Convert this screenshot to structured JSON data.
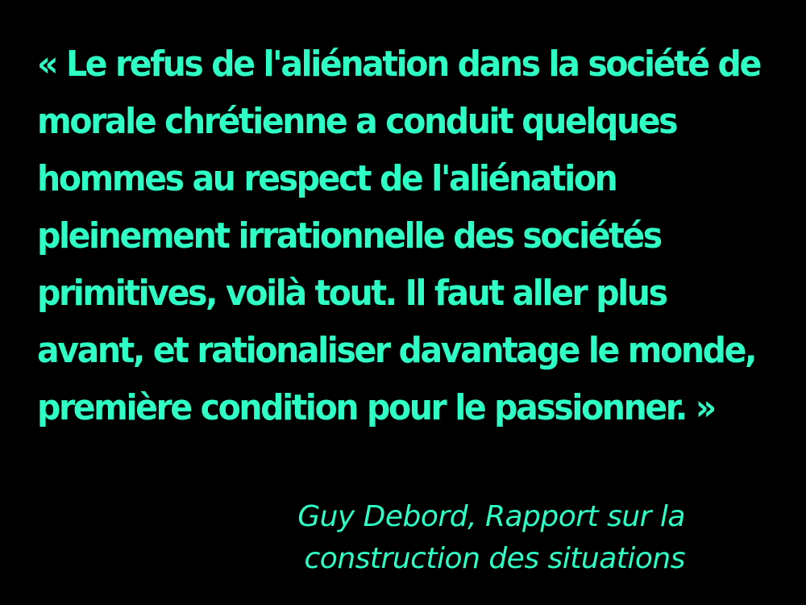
{
  "colors": {
    "background": "#000000",
    "text": "#2effc4"
  },
  "quote": {
    "lines": [
      "« Le refus de l'aliénation dans la société de",
      "morale chrétienne a conduit quelques",
      "hommes au respect de l'aliénation",
      "pleinement irrationnelle des sociétés",
      "primitives, voilà tout. Il faut aller plus",
      "avant, et rationaliser davantage le monde,",
      "première condition pour le passionner. »"
    ]
  },
  "attribution": {
    "lines": [
      "Guy Debord, Rapport sur la",
      "construction des situations"
    ]
  }
}
